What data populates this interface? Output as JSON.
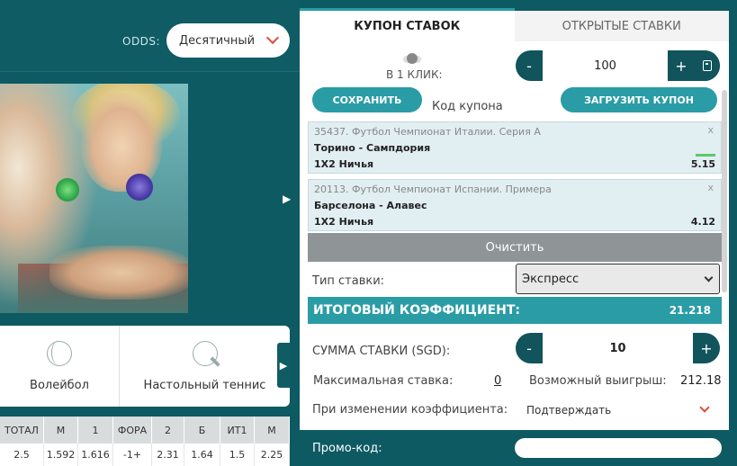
{
  "odds": {
    "label": "ODDS:",
    "selected": "Десятичный"
  },
  "sports": [
    {
      "name": "Волейбол",
      "icon": "volleyball-icon"
    },
    {
      "name": "Настольный теннис",
      "icon": "table-tennis-icon"
    }
  ],
  "odds_table": {
    "headers": [
      "ТОТАЛ",
      "М",
      "1",
      "ФОРА",
      "2",
      "Б",
      "ИТ1",
      "М"
    ],
    "row": [
      "2.5",
      "1.592",
      "1.616",
      "-1+",
      "2.31",
      "1.64",
      "1.5",
      "2.25"
    ]
  },
  "coupon": {
    "tabs": [
      "КУПОН СТАВОК",
      "ОТКРЫТЫЕ СТАВКИ"
    ],
    "one_click_label": "В 1 КЛИК:",
    "one_click_amount": "100",
    "save_label": "СОХРАНИТЬ",
    "coupon_code_label": "Код купона",
    "load_label": "ЗАГРУЗИТЬ КУПОН",
    "bets": [
      {
        "league": "35437. Футбол Чемпионат Италии. Серия А",
        "match": "Торино - Сампдория",
        "market": "1X2 Ничья",
        "coef": "5.15"
      },
      {
        "league": "20113. Футбол Чемпионат Испании. Примера",
        "match": "Барселона - Алавес",
        "market": "1X2 Ничья",
        "coef": "4.12"
      }
    ],
    "clear_label": "Очистить",
    "bet_type_label": "Тип ставки:",
    "bet_type_value": "Экспресс",
    "total_label": "ИТОГОВЫЙ КОЭФФИЦИЕНТ:",
    "total_value": "21.218",
    "stake_label": "СУММА СТАВКИ (SGD):",
    "stake_value": "10",
    "max_stake_label": "Максимальная ставка:",
    "max_stake_value": "0",
    "possible_win_label": "Возможный выигрыш:",
    "possible_win_value": "212.18",
    "on_change_label": "При изменении коэффициента:",
    "on_change_value": "Подтверждать",
    "promo_label": "Промо-код:",
    "close_glyph": "x",
    "minus": "-",
    "plus": "+"
  }
}
